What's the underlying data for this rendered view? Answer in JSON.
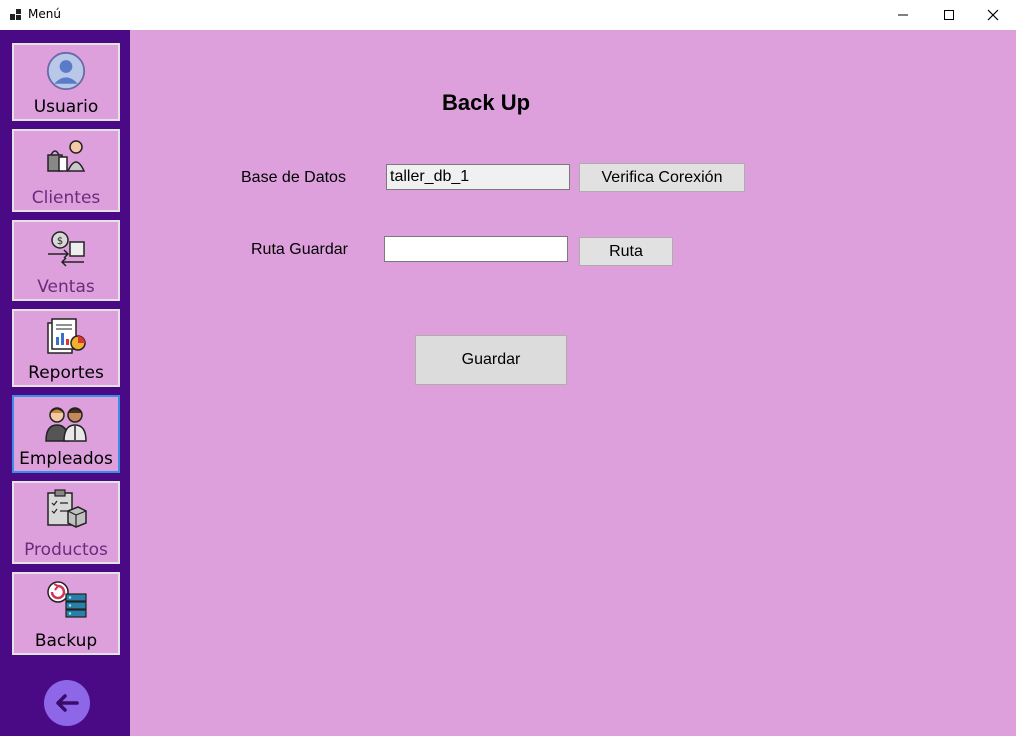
{
  "window": {
    "title": "Menú"
  },
  "sidebar": {
    "items": [
      {
        "label": "Usuario",
        "icon": "user-avatar-icon"
      },
      {
        "label": "Clientes",
        "icon": "clients-icon"
      },
      {
        "label": "Ventas",
        "icon": "sales-icon"
      },
      {
        "label": "Reportes",
        "icon": "reports-icon"
      },
      {
        "label": "Empleados",
        "icon": "employees-icon"
      },
      {
        "label": "Productos",
        "icon": "products-icon"
      },
      {
        "label": "Backup",
        "icon": "backup-icon"
      }
    ],
    "back_icon": "arrow-left-icon"
  },
  "main": {
    "title": "Back Up",
    "database_label": "Base de Datos",
    "database_value": "taller_db_1",
    "verify_button": "Verifica Corexión",
    "path_label": "Ruta Guardar",
    "path_value": "",
    "path_button": "Ruta",
    "save_button": "Guardar"
  },
  "colors": {
    "sidebar": "#4a0a86",
    "main_bg": "#dda0dd",
    "button": "#e1e1e1",
    "active_border": "#3a8ee6"
  }
}
